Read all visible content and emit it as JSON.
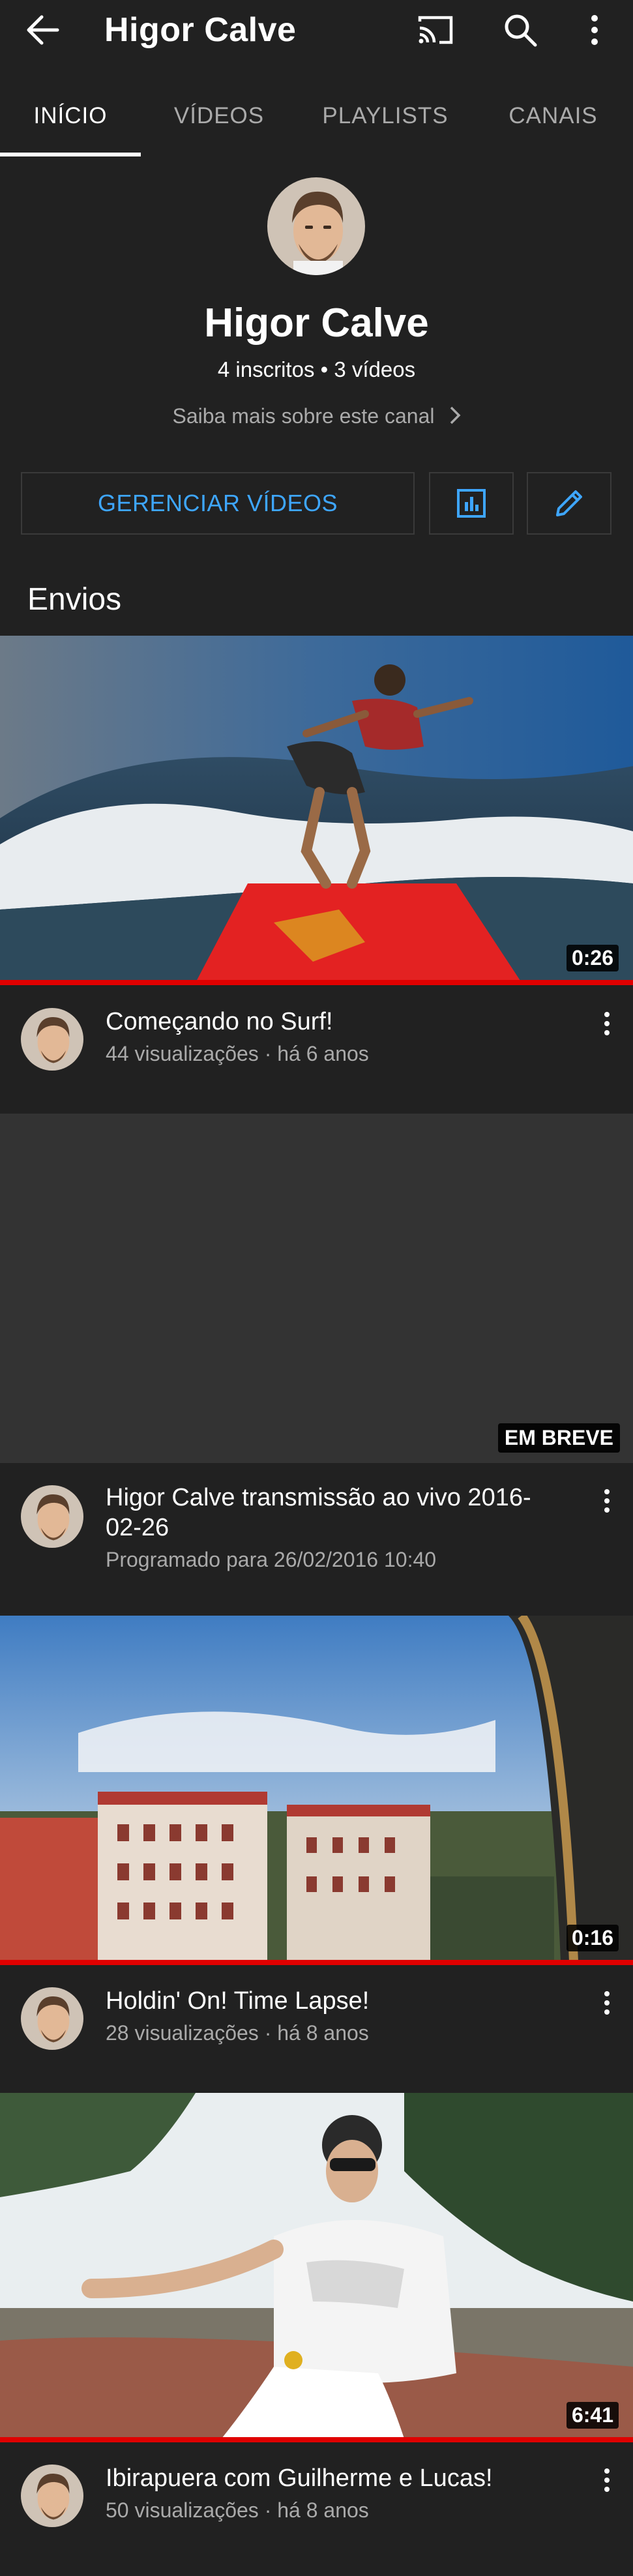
{
  "header": {
    "title": "Higor Calve",
    "back_icon": "arrow-left-icon",
    "cast_icon": "cast-icon",
    "search_icon": "search-icon",
    "more_icon": "more-vert-icon"
  },
  "tabs": [
    {
      "label": "INÍCIO",
      "active": true
    },
    {
      "label": "VÍDEOS",
      "active": false
    },
    {
      "label": "PLAYLISTS",
      "active": false
    },
    {
      "label": "CANAIS",
      "active": false
    }
  ],
  "channel": {
    "name": "Higor Calve",
    "stats": "4 inscritos • 3 vídeos",
    "about": "Saiba mais sobre este canal"
  },
  "actions": {
    "manage_label": "GERENCIAR VÍDEOS",
    "analytics_icon": "analytics-icon",
    "edit_icon": "pencil-icon",
    "accent_color": "#3ea6ff"
  },
  "section": {
    "title": "Envios"
  },
  "videos": [
    {
      "title": "Começando no Surf!",
      "meta": "44 visualizações · há 6 anos",
      "duration": "0:26",
      "watched": 1.0
    },
    {
      "title": "Higor Calve transmissão ao vivo 2016-02-26",
      "meta": "Programado para 26/02/2016 10:40",
      "badge": "EM BREVE"
    },
    {
      "title": "Holdin' On! Time Lapse!",
      "meta": "28 visualizações · há 8 anos",
      "duration": "0:16",
      "watched": 1.0
    },
    {
      "title": "Ibirapuera com Guilherme e Lucas!",
      "meta": "50 visualizações · há 8 anos",
      "duration": "6:41",
      "watched": 1.0
    }
  ],
  "colors": {
    "background": "#212121",
    "progress": "#e00000",
    "secondary_text": "#aaaaaa"
  }
}
